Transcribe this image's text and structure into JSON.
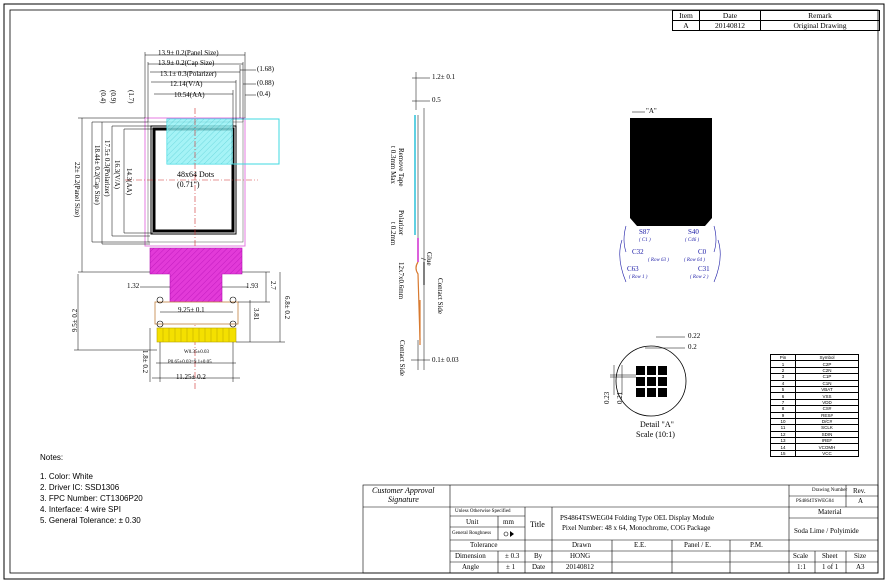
{
  "revision_table": {
    "headers": [
      "Item",
      "Date",
      "Remark"
    ],
    "rows": [
      [
        "A",
        "20140812",
        "Original Drawing"
      ]
    ]
  },
  "front_view": {
    "dims": {
      "panel_size": "13.9± 0.2(Panel Size)",
      "cap_size": "13.9± 0.2(Cap Size)",
      "polarizer": "13.1± 0.3(Polarizer)",
      "va": "12.14(V/A)",
      "aa": "10.54(AA)",
      "r168": "(1.68)",
      "r088": "(0.88)",
      "r04": "(0.4)",
      "l04": "(0.4)",
      "l09": "(0.9)",
      "l17": "(1.7)",
      "aa_v": "14.3(AA)",
      "va_v": "16.3(V/A)",
      "pol_v": "17.5± 0.3(Polarizer)",
      "cap_v": "18.44± 0.2(Cap Size)",
      "panel_v": "22± 0.2(Panel Size)",
      "d132": "1.32",
      "d193": "1.93",
      "d925": "9.25± 0.1",
      "d27": "2.7",
      "d381": "3.81",
      "d68": "6.8± 0.2",
      "d95": "9.5± 0.2",
      "d18": "1.8± 0.2",
      "d1125": "11.25± 0.2",
      "pitch1": "P0.65±0.03=9.1±0.05",
      "pitch2": "W0.35±0.03"
    },
    "dots_label": "48x64 Dots",
    "diag_label": "(0.71\")"
  },
  "side_view": {
    "dims": {
      "d12": "1.2± 0.1",
      "d05": "0.5",
      "d01": "0.1± 0.03"
    },
    "labels": {
      "remove_tape": "Remove Tape",
      "t03max": "t 0.3mm Max",
      "polarizer": "Polarizer",
      "t02": "t 0.2mm",
      "glue": "Glue",
      "contact_side": "Contact Side",
      "r": "12x7x0.6mm",
      "contact_side2": "Contact Side"
    }
  },
  "back_view": {
    "marker": "\"A\"",
    "s87": "S87",
    "c1": "( C1 )",
    "s40": "S40",
    "c46": "( C46 )",
    "c32": "C32",
    "row63": "( Row 63 )",
    "c0": "C0",
    "row64": "( Row 64 )",
    "c63": "C63",
    "row1": "( Row 1 )",
    "c31": "C31",
    "row2": "( Row 2 )"
  },
  "detail": {
    "d022": "0.22",
    "d02": "0.2",
    "d023": "0.23",
    "d021": "0.21",
    "title": "Detail \"A\"",
    "scale": "Scale (10:1)"
  },
  "pin_table": {
    "headers": [
      "Pin",
      "Symbol"
    ],
    "rows": [
      [
        "1",
        "C2P"
      ],
      [
        "2",
        "C2N"
      ],
      [
        "3",
        "C1P"
      ],
      [
        "4",
        "C1N"
      ],
      [
        "5",
        "VBAT"
      ],
      [
        "6",
        "VSS"
      ],
      [
        "7",
        "VDD"
      ],
      [
        "8",
        "CS#"
      ],
      [
        "9",
        "RES#"
      ],
      [
        "10",
        "D/C#"
      ],
      [
        "11",
        "SCLK"
      ],
      [
        "12",
        "SDIN"
      ],
      [
        "13",
        "IREF"
      ],
      [
        "14",
        "VCOMH"
      ],
      [
        "15",
        "VCC"
      ]
    ]
  },
  "notes": {
    "title": "Notes:",
    "items": [
      "1. Color: White",
      "2. Driver IC: SSD1306",
      "3. FPC Number: CT1306P20",
      "4. Interface: 4  wire  SPI",
      "5. General Tolerance: ± 0.30"
    ]
  },
  "title_block": {
    "customer_approval": "Customer Approval",
    "signature": "Signature",
    "unless": "Unless Otherwise Specified",
    "unit": "Unit",
    "unit_val": "mm",
    "general_roughness": "General Roughness",
    "tolerance": "Tolerance",
    "dimension": "Dimension",
    "dimension_val": "± 0.3",
    "angle": "Angle",
    "angle_val": "± 1",
    "title_label": "Title",
    "title_line1": "PS4864TSWEG04 Folding Type OEL Display Module",
    "title_line2": "Pixel Number: 48 x 64, Monochrome, COG Package",
    "drawing_number_label": "Drawing Number",
    "drawing_number": "PS4864TSWEG04",
    "rev_label": "Rev.",
    "rev": "A",
    "material_label": "Material",
    "material": "Soda Lime / Polyimide",
    "drawn": "Drawn",
    "ee": "E.E.",
    "panel": "Panel / E.",
    "pm": "P.M.",
    "by": "By",
    "hong": "HONG",
    "date_label": "Date",
    "date_val": "20140812",
    "scale_label": "Scale",
    "sheet_label": "Sheet",
    "size_label": "Size",
    "scale_val": "1:1",
    "sheet_val": "1 of 1",
    "size_val": "A3"
  }
}
